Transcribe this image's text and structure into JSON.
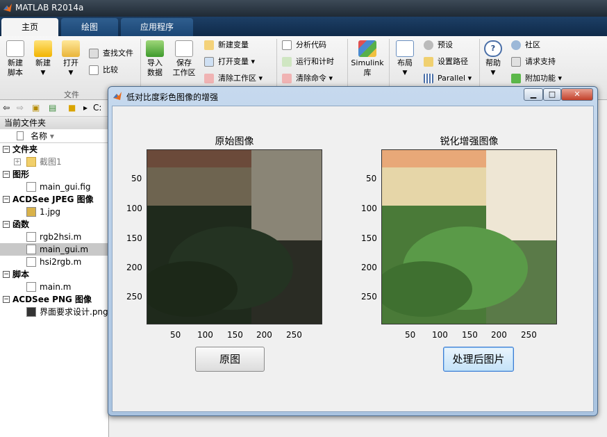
{
  "app": {
    "title": "MATLAB R2014a"
  },
  "tabs": [
    "主页",
    "绘图",
    "应用程序"
  ],
  "ribbon": {
    "new_script": "新建\n脚本",
    "new": "新建",
    "open": "打开",
    "find_files": "查找文件",
    "compare": "比较",
    "import_data": "导入\n数据",
    "save_workspace": "保存\n工作区",
    "new_variable": "新建变量",
    "open_variable": "打开变量",
    "clear_workspace": "清除工作区",
    "analyze_code": "分析代码",
    "run_and_time": "运行和计时",
    "clear_commands": "清除命令",
    "simulink": "Simulink\n库",
    "layout": "布局",
    "preferences": "预设",
    "set_path": "设置路径",
    "parallel": "Parallel",
    "help": "帮助",
    "community": "社区",
    "request_support": "请求支持",
    "add_ons": "附加功能",
    "group_file": "文件"
  },
  "address": {
    "path": "C:"
  },
  "current_folder": {
    "header": "当前文件夹",
    "column_name": "名称",
    "sections": [
      {
        "label": "文件夹",
        "items": [
          "截图1"
        ]
      },
      {
        "label": "图形",
        "items": [
          "main_gui.fig"
        ]
      },
      {
        "label": "ACDSee JPEG 图像",
        "items": [
          "1.jpg"
        ]
      },
      {
        "label": "函数",
        "items": [
          "rgb2hsi.m",
          "main_gui.m",
          "hsi2rgb.m"
        ]
      },
      {
        "label": "脚本",
        "items": [
          "main.m"
        ]
      },
      {
        "label": "ACDSee PNG 图像",
        "items": [
          "界面要求设计.png"
        ]
      }
    ]
  },
  "figure": {
    "title": "低对比度彩色图像的增强",
    "axes_left_title": "原始图像",
    "axes_right_title": "锐化增强图像",
    "yticks": [
      "50",
      "100",
      "150",
      "200",
      "250"
    ],
    "xticks": [
      "50",
      "100",
      "150",
      "200",
      "250"
    ],
    "button_original": "原图",
    "button_processed": "处理后图片"
  },
  "colors": {
    "tab_bar": "#1d3f66",
    "active_tab": "#f4f4f4",
    "selected_row": "#c8c8c8"
  }
}
